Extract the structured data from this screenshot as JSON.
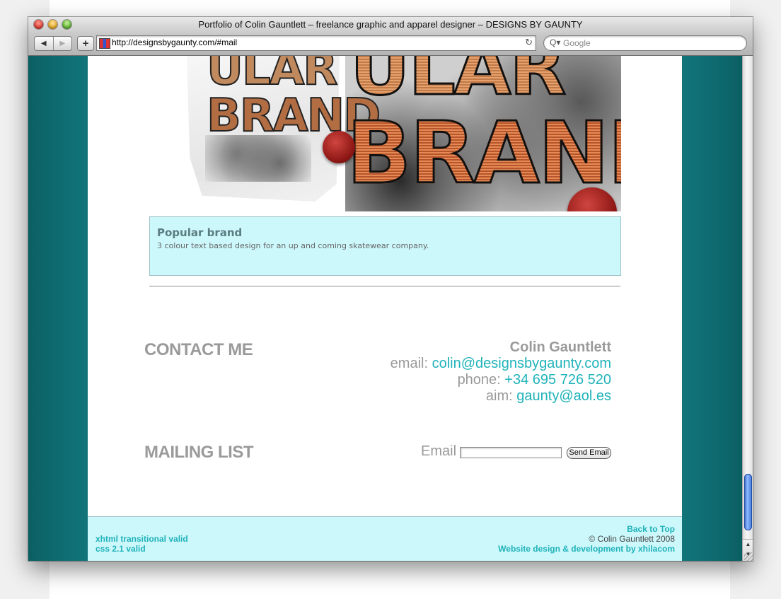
{
  "browser": {
    "window_title": "Portfolio of Colin Gauntlett – freelance graphic and apparel designer – DESIGNS BY GAUNTY",
    "url": "http://designsbygaunty.com/#mail",
    "search_placeholder": "Google",
    "back_glyph": "◀",
    "forward_glyph": "▶",
    "add_glyph": "+",
    "reload_glyph": "↻",
    "search_glyph": "Q▾"
  },
  "colors": {
    "accent": "#1fb3b9",
    "panel_bg": "#ccf7fb",
    "side_bg": "#0d6b70",
    "heading_gray": "#9a9a9a"
  },
  "hero": {
    "art_text_line1": "ULAR",
    "art_text_line2": "BRAND"
  },
  "caption": {
    "title": "Popular brand",
    "description": "3 colour text based design for an up and coming skatewear company."
  },
  "contact": {
    "heading": "CONTACT ME",
    "name": "Colin Gauntlett",
    "email_label": "email:",
    "email": "colin@designsbygaunty.com",
    "phone_label": "phone:",
    "phone": "+34 695 726 520",
    "aim_label": "aim:",
    "aim": "gaunty@aol.es"
  },
  "mailing": {
    "heading": "MAILING LIST",
    "email_label": "Email",
    "email_value": "",
    "send_label": "Send Email"
  },
  "footer": {
    "xhtml": "xhtml transitional valid",
    "css": "css 2.1 valid",
    "back_to_top": "Back to Top",
    "copyright": "© Colin Gauntlett 2008",
    "credit": "Website design & development by xhilacom"
  },
  "scrollbar": {
    "up_glyph": "▲",
    "down_glyph": "▼"
  }
}
